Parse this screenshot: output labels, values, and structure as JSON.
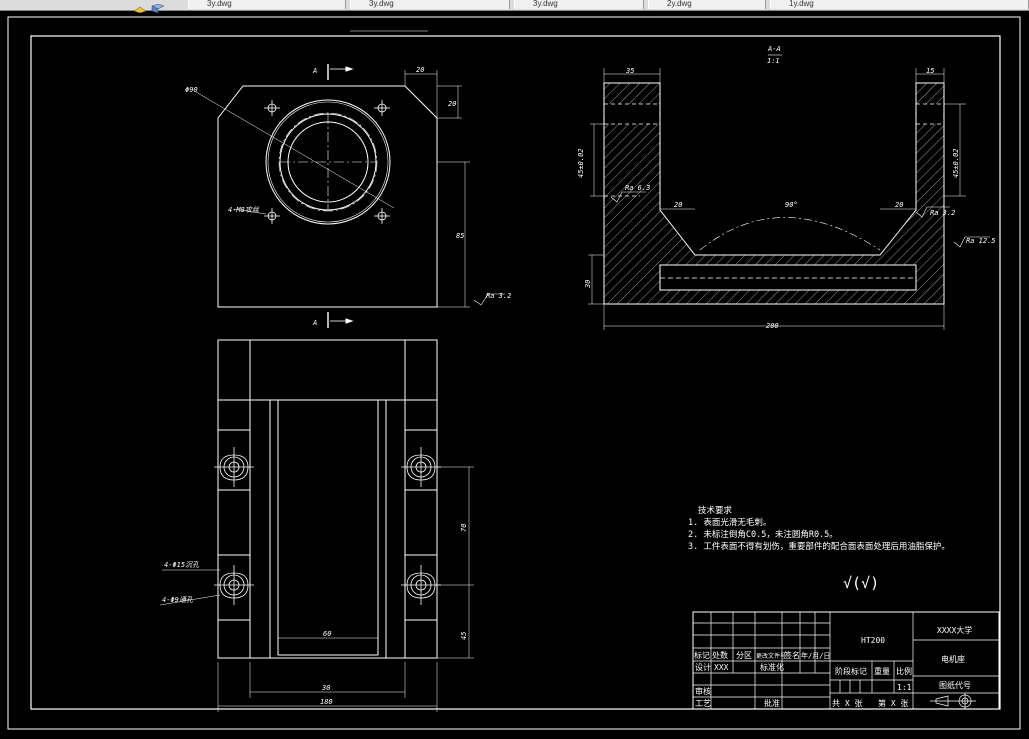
{
  "tabs": [
    "3y.dwg",
    "3y.dwg",
    "3y.dwg",
    "2y.dwg",
    "1y.dwg"
  ],
  "drawing": {
    "section_title": "A-A",
    "section_scale": "1:1",
    "section_mark": "A",
    "dims": {
      "top_w20": "20",
      "top_h20": "20",
      "dia90": "Φ90",
      "h85": "85",
      "bolt_holes": "4-M8攻丝",
      "ra_front": "Ra 3.2",
      "sec_35": "35",
      "sec_15": "15",
      "sec_left_h": "45±0.02",
      "sec_right_h": "45±0.02",
      "ra_63": "Ra 6.3",
      "sec_20a": "20",
      "sec_20b": "20",
      "angle": "90°",
      "ra_32b": "Ra 3.2",
      "ra_125": "Ra 12.5",
      "sec_30": "30",
      "sec_200": "200",
      "plan_h70": "70",
      "plan_h45": "45",
      "plan_w60": "60",
      "plan_w30": "30",
      "plan_w180": "180",
      "counterbore": "4-Φ15沉孔",
      "thru": "4-Φ9通孔"
    },
    "notes": {
      "title": "技术要求",
      "lines": [
        "1. 表面光滑无毛刺。",
        "2. 未标注倒角C0.5，未注圆角R0.5。",
        "3. 工件表面不得有划伤，重要部件的配合面表面处理后用油脂保护。"
      ]
    },
    "rough_symbol": "√(√)"
  },
  "title_block": {
    "material": "HT200",
    "school": "XXXX大学",
    "part_name": "电机座",
    "drawing_no": "图纸代号",
    "scale": "1:1",
    "stage_mark": "阶段标记",
    "weight": "重量",
    "ratio": "比例",
    "sheets": "共 X 张",
    "sheet": "第 X 张",
    "headers": [
      "标记",
      "处数",
      "分区",
      "更改文件号",
      "签名",
      "年/月/日"
    ],
    "design": "设计",
    "designer": "XXX",
    "standard": "标准化",
    "review": "审核",
    "process": "工艺",
    "approve": "批准"
  }
}
